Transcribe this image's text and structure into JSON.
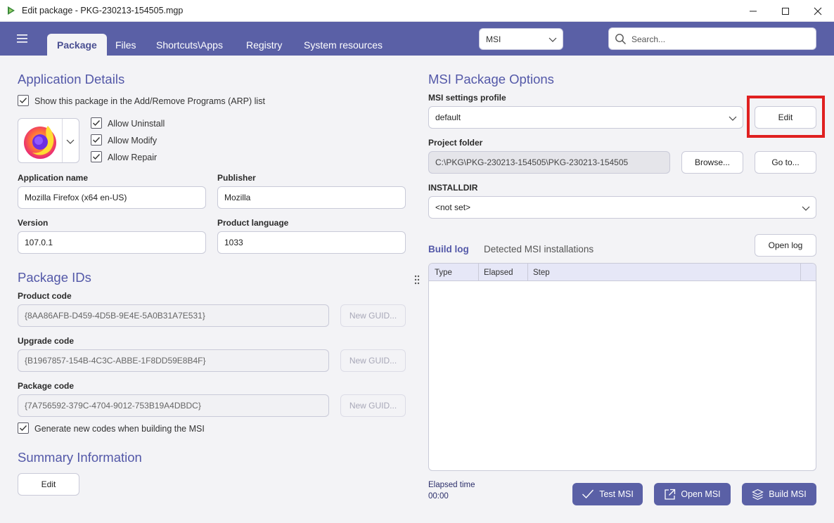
{
  "window": {
    "title": "Edit package - PKG-230213-154505.mgp"
  },
  "toolbar": {
    "tabs": [
      {
        "label": "Package",
        "active": true
      },
      {
        "label": "Files"
      },
      {
        "label": "Shortcuts\\Apps"
      },
      {
        "label": "Registry"
      },
      {
        "label": "System resources"
      }
    ],
    "package_type": "MSI",
    "search_placeholder": "Search...",
    "accent_color": "#5a60a6"
  },
  "app_details": {
    "title": "Application Details",
    "show_in_arp": "Show this package in the Add/Remove Programs (ARP) list",
    "allow_uninstall": "Allow Uninstall",
    "allow_modify": "Allow Modify",
    "allow_repair": "Allow Repair",
    "app_name_label": "Application name",
    "app_name": "Mozilla Firefox (x64 en-US)",
    "publisher_label": "Publisher",
    "publisher": "Mozilla",
    "version_label": "Version",
    "version": "107.0.1",
    "language_label": "Product language",
    "language": "1033",
    "icon": "firefox-logo"
  },
  "package_ids": {
    "title": "Package IDs",
    "product_code_label": "Product code",
    "product_code": "{8AA86AFB-D459-4D5B-9E4E-5A0B31A7E531}",
    "upgrade_code_label": "Upgrade code",
    "upgrade_code": "{B1967857-154B-4C3C-ABBE-1F8DD59E8B4F}",
    "package_code_label": "Package code",
    "package_code": "{7A756592-379C-4704-9012-753B19A4DBDC}",
    "new_guid": "New GUID...",
    "generate_codes": "Generate new codes when building the MSI"
  },
  "summary": {
    "title": "Summary Information",
    "edit": "Edit"
  },
  "msi_options": {
    "title": "MSI Package Options",
    "profile_label": "MSI settings profile",
    "profile_value": "default",
    "edit": "Edit",
    "project_folder_label": "Project folder",
    "project_folder": "C:\\PKG\\PKG-230213-154505\\PKG-230213-154505",
    "browse": "Browse...",
    "goto": "Go to...",
    "installdir_label": "INSTALLDIR",
    "installdir_value": "<not set>"
  },
  "build": {
    "log_tab": "Build log",
    "detected_tab": "Detected MSI installations",
    "open_log": "Open log",
    "columns": [
      "Type",
      "Elapsed",
      "Step"
    ],
    "elapsed_label": "Elapsed time",
    "elapsed_value": "00:00",
    "test_msi": "Test MSI",
    "open_msi": "Open MSI",
    "build_msi": "Build MSI"
  }
}
